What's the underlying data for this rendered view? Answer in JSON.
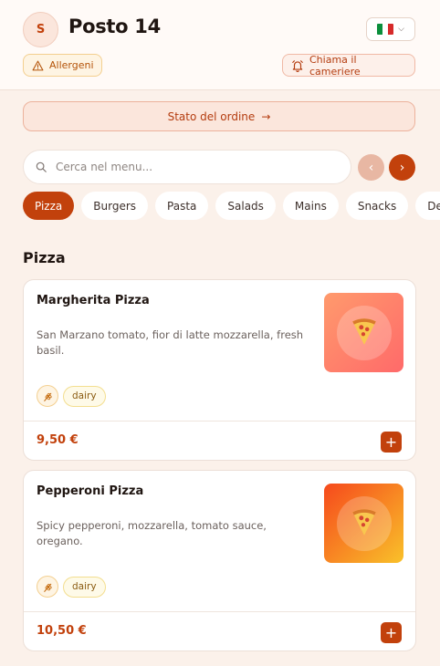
{
  "header": {
    "avatar_initial": "S",
    "title": "Posto 14",
    "language": "Italiano",
    "allergens_label": "Allergeni",
    "call_waiter_label": "Chiama il cameriere"
  },
  "order_status": {
    "label": "Stato del ordine",
    "arrow": "→"
  },
  "search": {
    "placeholder": "Cerca nel menu..."
  },
  "nav": {
    "prev": "‹",
    "next": "›"
  },
  "categories": [
    {
      "label": "Pizza",
      "active": true
    },
    {
      "label": "Burgers",
      "active": false
    },
    {
      "label": "Pasta",
      "active": false
    },
    {
      "label": "Salads",
      "active": false
    },
    {
      "label": "Mains",
      "active": false
    },
    {
      "label": "Snacks",
      "active": false
    },
    {
      "label": "Desserts",
      "active": false
    }
  ],
  "section": {
    "title": "Pizza"
  },
  "items": [
    {
      "name": "Margherita Pizza",
      "description": "San Marzano tomato, fior di latte mozzarella, fresh basil.",
      "tags": [
        "gluten",
        "dairy"
      ],
      "dairy_label": "dairy",
      "price": "9,50 €",
      "add": "+",
      "thumb_gradient": [
        "#ff9a6c",
        "#ff6a6a"
      ]
    },
    {
      "name": "Pepperoni Pizza",
      "description": "Spicy pepperoni, mozzarella, tomato sauce, oregano.",
      "tags": [
        "gluten",
        "dairy"
      ],
      "dairy_label": "dairy",
      "price": "10,50 €",
      "add": "+",
      "thumb_gradient": [
        "#f6491c",
        "#f9c12a"
      ]
    }
  ],
  "colors": {
    "accent": "#c2410c",
    "background": "#fbf1ea"
  }
}
